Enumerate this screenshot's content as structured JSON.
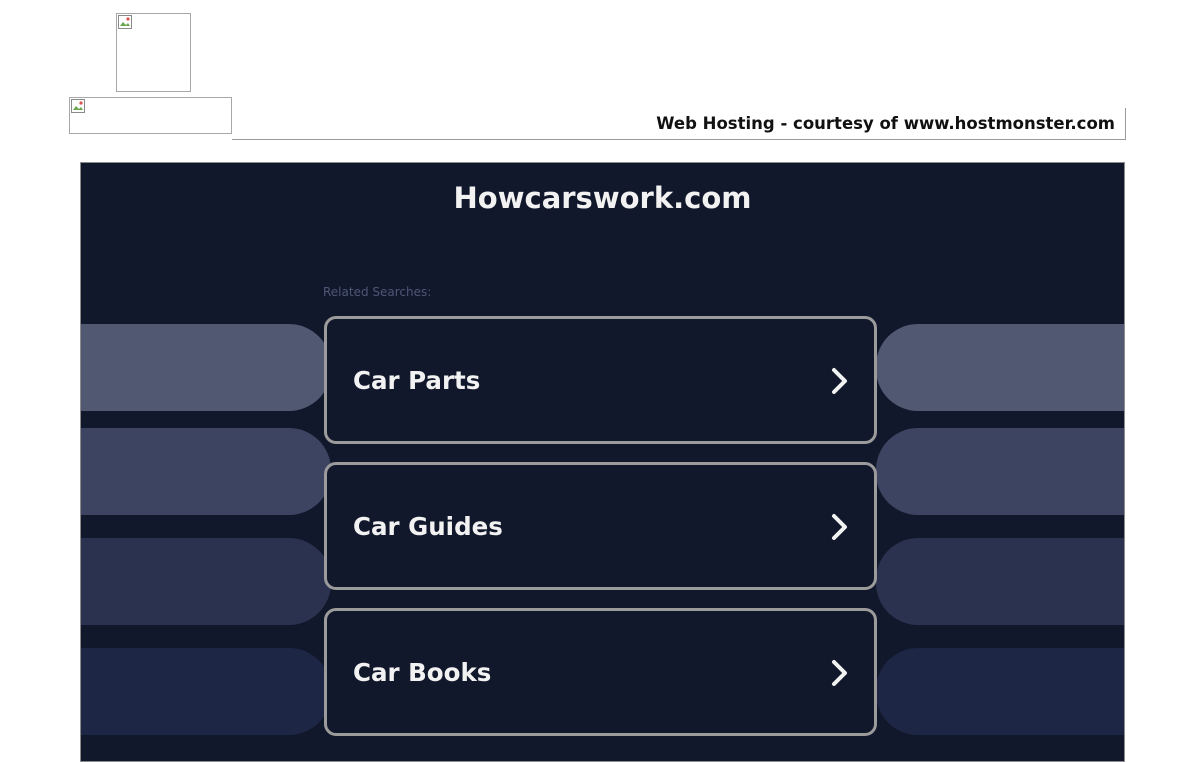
{
  "hosting_banner": {
    "text": "Web Hosting - courtesy of www.hostmonster.com"
  },
  "parked_page": {
    "title": "Howcarswork.com",
    "related_label": "Related Searches:",
    "searches": [
      {
        "label": "Car Parts",
        "icon": "chevron-right-icon"
      },
      {
        "label": "Car Guides",
        "icon": "chevron-right-icon"
      },
      {
        "label": "Car Books",
        "icon": "chevron-right-icon"
      }
    ]
  },
  "colors": {
    "panel_bg": "#12182b",
    "deco_band_1": "#505872",
    "deco_band_2": "#3d4461",
    "deco_band_3": "#2a3250",
    "deco_band_4": "#1d2645",
    "card_border": "#9b9b9b",
    "text_light": "#f2f2f2",
    "label_muted": "#4d5676"
  }
}
